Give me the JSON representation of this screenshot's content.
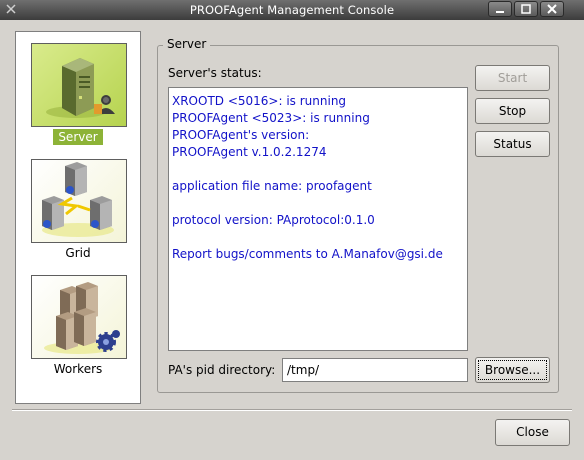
{
  "window": {
    "title": "PROOFAgent Management Console"
  },
  "sidebar": {
    "items": [
      {
        "label": "Server",
        "icon": "server-user-icon",
        "selected": true
      },
      {
        "label": "Grid",
        "icon": "grid-network-icon",
        "selected": false
      },
      {
        "label": "Workers",
        "icon": "workers-gear-icon",
        "selected": false
      }
    ]
  },
  "server_panel": {
    "group_title": "Server",
    "status_label": "Server's status:",
    "status_lines": [
      "XROOTD <5016>: is running",
      "PROOFAgent <5023>: is running",
      "PROOFAgent's version:",
      "PROOFAgent v.1.0.2.1274",
      "",
      "application file name: proofagent",
      "",
      "protocol version: PAprotocol:0.1.0",
      "",
      "Report bugs/comments to A.Manafov@gsi.de"
    ],
    "buttons": {
      "start": "Start",
      "stop": "Stop",
      "status": "Status",
      "browse": "Browse..."
    },
    "pid_label": "PA's pid directory:",
    "pid_value": "/tmp/"
  },
  "footer": {
    "close": "Close"
  },
  "colors": {
    "selection_green": "#8db337",
    "status_text_blue": "#1212c8",
    "window_bg": "#d6d3ce"
  }
}
